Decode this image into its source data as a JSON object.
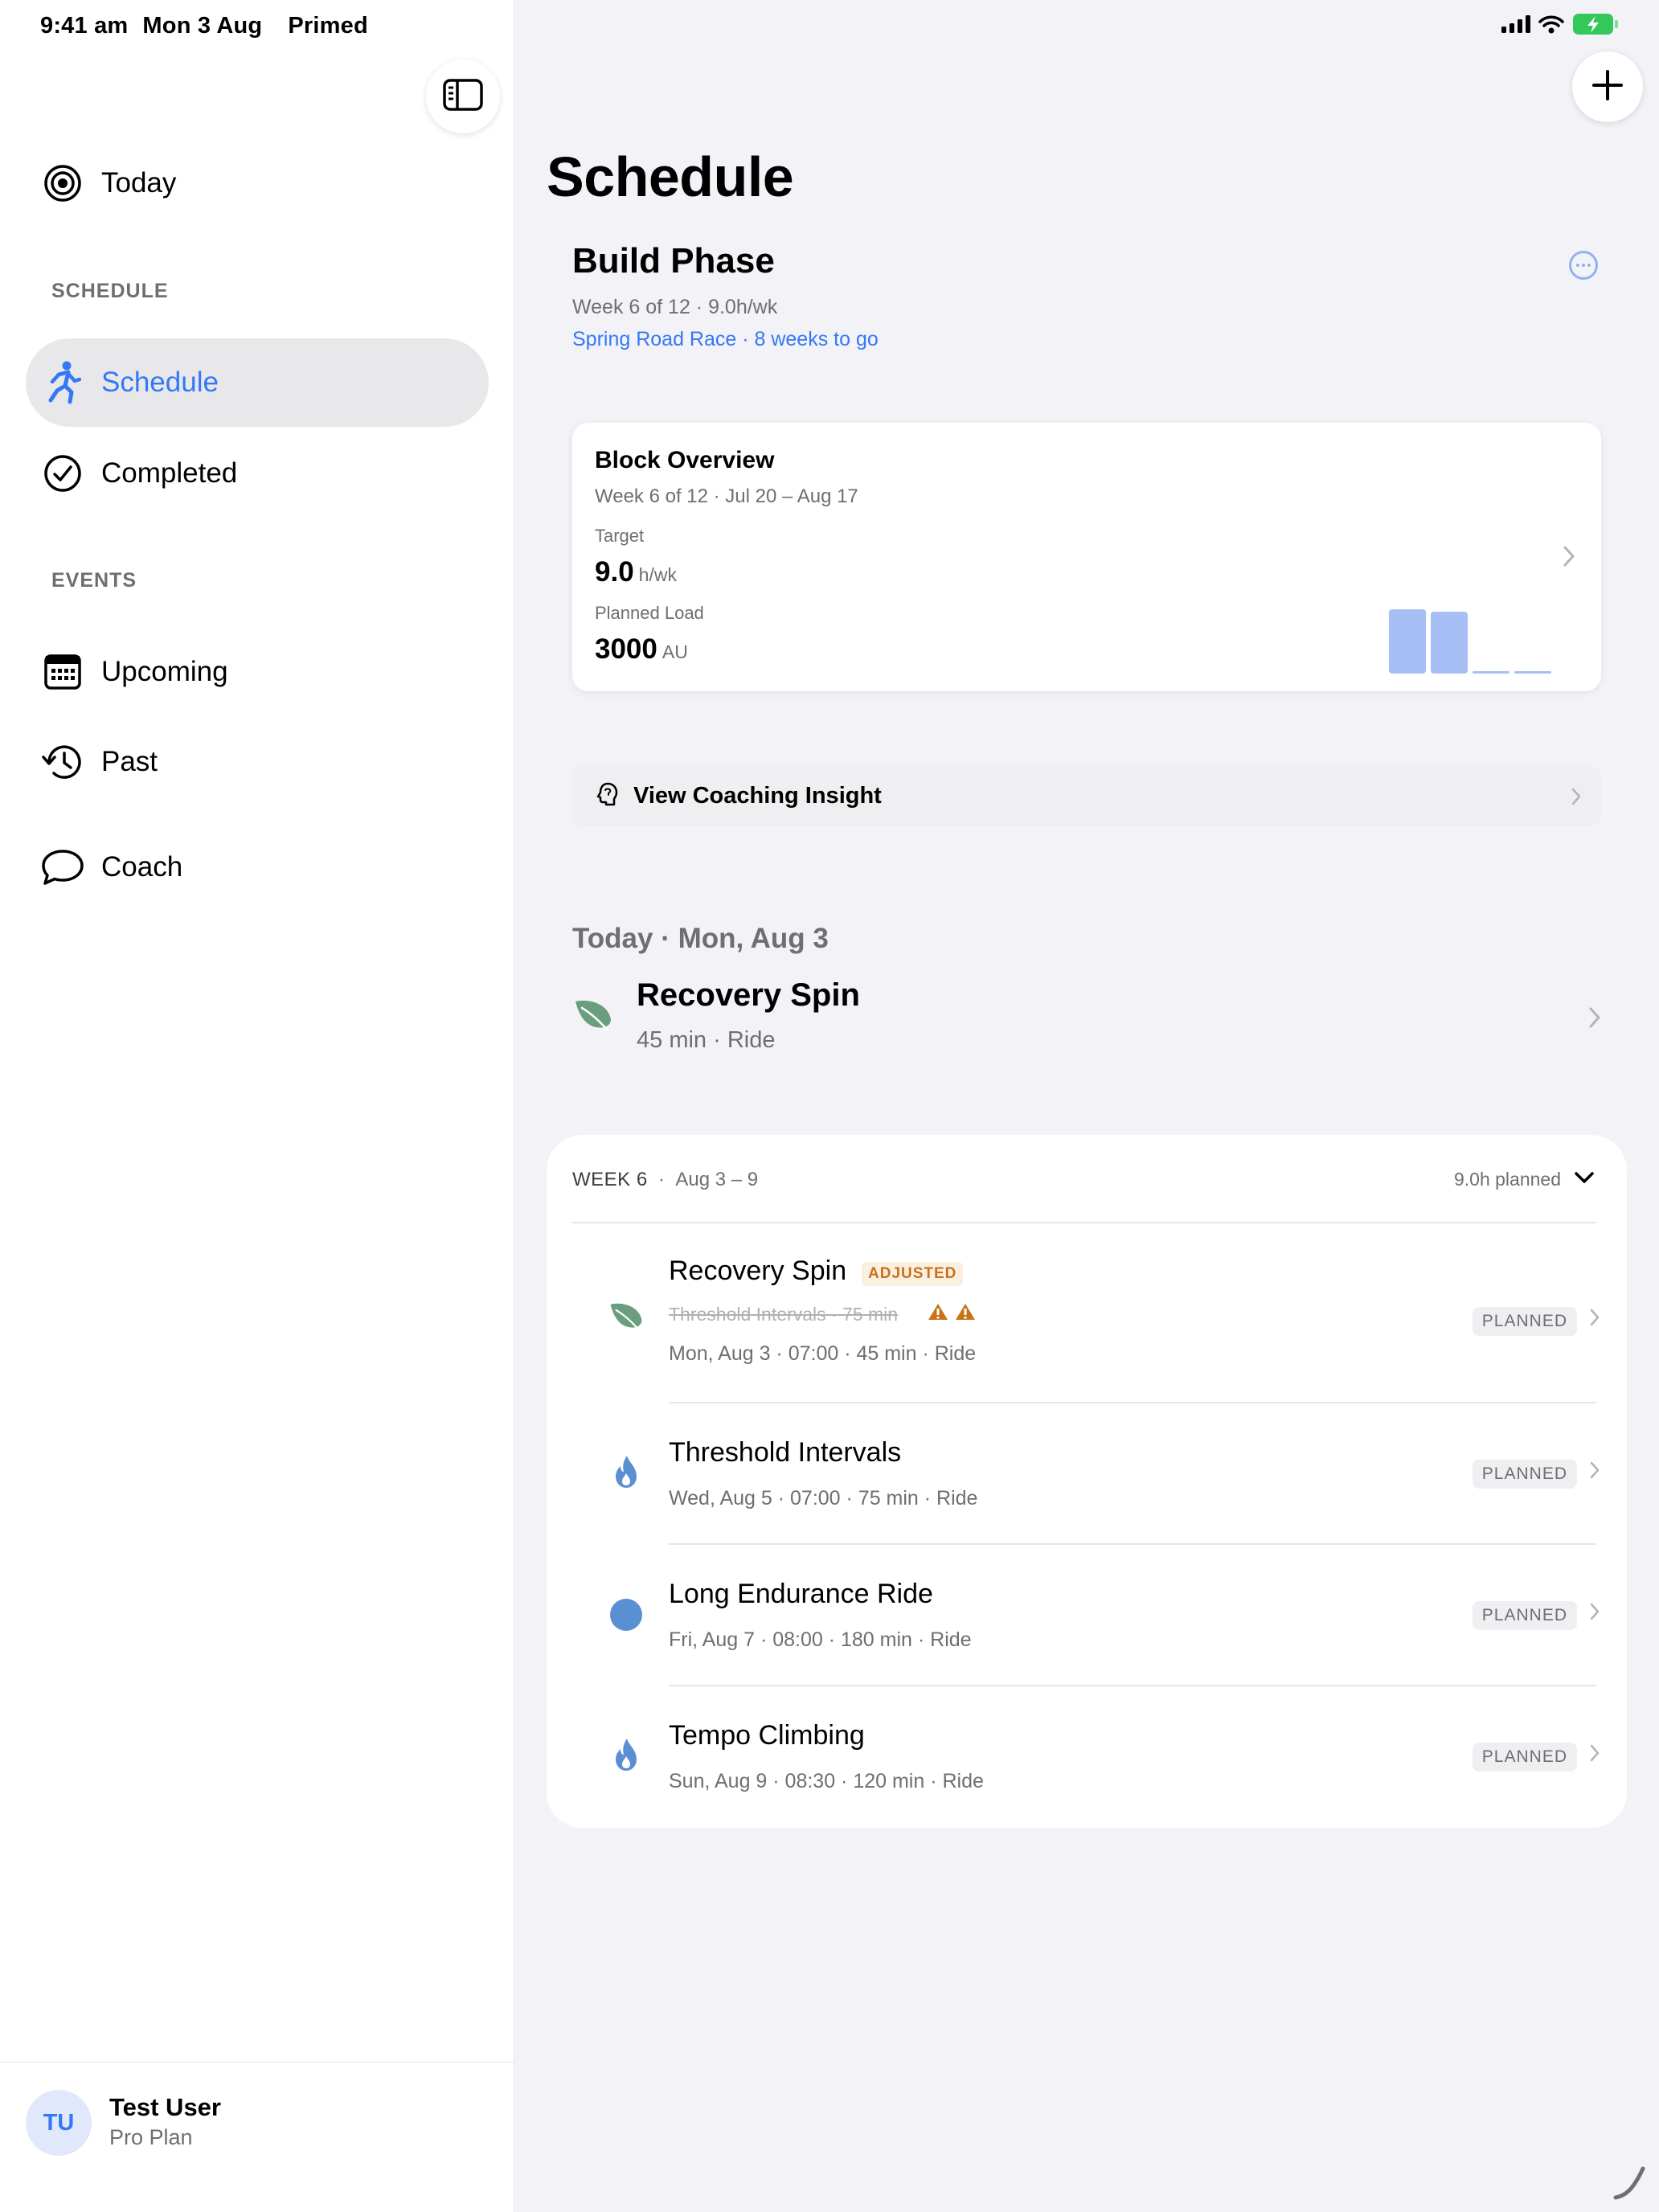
{
  "status_bar": {
    "time": "9:41 am",
    "date": "Mon 3 Aug",
    "app_name": "Primed"
  },
  "sidebar": {
    "today_label": "Today",
    "sections": {
      "schedule_header": "SCHEDULE",
      "events_header": "EVENTS"
    },
    "items": {
      "schedule": "Schedule",
      "completed": "Completed",
      "upcoming": "Upcoming",
      "past": "Past",
      "coach": "Coach"
    },
    "active_item": "Schedule",
    "accent_color": "#3478f6"
  },
  "profile": {
    "initials": "TU",
    "name": "Test User",
    "plan": "Pro Plan"
  },
  "main": {
    "title": "Schedule",
    "phase": {
      "name": "Build Phase",
      "meta": "Week 6 of 12 · 9.0h/wk",
      "link": "Spring Road Race · 8 weeks to go"
    },
    "block_overview": {
      "title": "Block Overview",
      "subtitle": "Week 6 of 12 · Jul 20 – Aug 17",
      "target_label": "Target",
      "target_value": "9.0",
      "target_unit": "h/wk",
      "load_label": "Planned Load",
      "load_value": "3000",
      "load_unit": "AU",
      "weekly_load_fraction": [
        1.0,
        0.96,
        0.0,
        0.0
      ]
    },
    "insight_label": "View Coaching Insight",
    "today": {
      "header": "Today · Mon, Aug 3",
      "workout_title": "Recovery Spin",
      "workout_meta": "45 min · Ride",
      "icon": "leaf-icon"
    },
    "week": {
      "label": "WEEK 6",
      "range": "Aug 3 – 9",
      "planned": "9.0h planned",
      "workouts": [
        {
          "title": "Recovery Spin",
          "badge": "ADJUSTED",
          "original": "Threshold Intervals · 75 min",
          "meta": "Mon, Aug 3 · 07:00 · 45 min · Ride",
          "status": "PLANNED",
          "icon": "leaf-icon"
        },
        {
          "title": "Threshold Intervals",
          "meta": "Wed, Aug 5 · 07:00 · 75 min · Ride",
          "status": "PLANNED",
          "icon": "flame-icon"
        },
        {
          "title": "Long Endurance Ride",
          "meta": "Fri, Aug 7 · 08:00 · 180 min · Ride",
          "status": "PLANNED",
          "icon": "circle-icon"
        },
        {
          "title": "Tempo Climbing",
          "meta": "Sun, Aug 9 · 08:30 · 120 min · Ride",
          "status": "PLANNED",
          "icon": "flame-icon"
        }
      ]
    }
  },
  "colors": {
    "leaf": "#6a9e7e",
    "flame": "#5b8fd4",
    "warning": "#c8731a",
    "bar": "#a8bff6"
  }
}
